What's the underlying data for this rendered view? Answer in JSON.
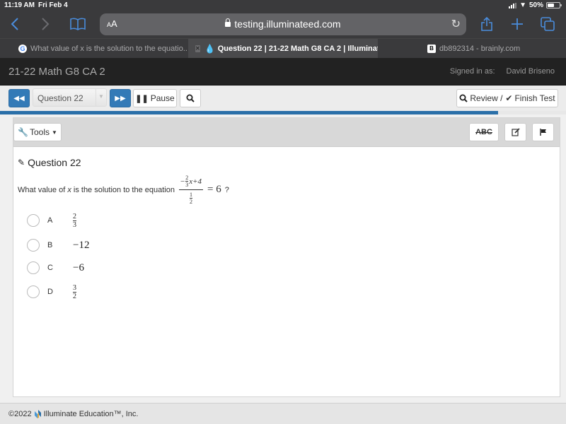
{
  "status_bar": {
    "time": "11:19 AM",
    "date": "Fri Feb 4",
    "battery": "50%",
    "battery_level": 0.5
  },
  "browser": {
    "url_text_size": "AA",
    "url": "testing.illuminateed.com",
    "icons": {
      "back": "chevron-left-icon",
      "forward": "chevron-right-icon",
      "bookmarks": "book-icon",
      "reload": "reload-icon",
      "share": "share-icon",
      "new_tab": "plus-icon",
      "tabs": "tabs-icon"
    },
    "tabs": [
      {
        "title": "What value of x is the solution to the equatio...",
        "favicon": "google-icon",
        "active": false
      },
      {
        "title": "Question 22 | 21-22 Math G8 CA 2 | Illuminat...",
        "favicon": "illuminate-icon",
        "active": true
      },
      {
        "title": "db892314 - brainly.com",
        "favicon": "brainly-icon",
        "active": false
      }
    ]
  },
  "app": {
    "title": "21-22 Math G8 CA 2",
    "signed_in_label": "Signed in as:",
    "user_name": "David Briseno"
  },
  "test_toolbar": {
    "question_select": "Question 22",
    "pause_label": "Pause",
    "review_label": "Review /",
    "finish_label": "Finish Test",
    "progress": 0.88
  },
  "panel": {
    "tools_label": "Tools",
    "abc_label": "ABC",
    "question_title": "Question 22",
    "prompt_before": "What value of ",
    "prompt_var": "x",
    "prompt_after": " is the solution to the equation",
    "equation": {
      "numerator_sign": "−",
      "coef_num": "2",
      "coef_den": "3",
      "numerator_rest": "x+4",
      "denominator_num": "1",
      "denominator_den": "2",
      "rhs": "= 6"
    },
    "prompt_end": "?",
    "choices": [
      {
        "letter": "A",
        "type": "fraction",
        "num": "2",
        "den": "3"
      },
      {
        "letter": "B",
        "type": "text",
        "value": "−12"
      },
      {
        "letter": "C",
        "type": "text",
        "value": "−6"
      },
      {
        "letter": "D",
        "type": "fraction",
        "num": "3",
        "den": "2"
      }
    ]
  },
  "footer": {
    "copyright": "©2022",
    "company": "Illuminate Education™, Inc."
  }
}
